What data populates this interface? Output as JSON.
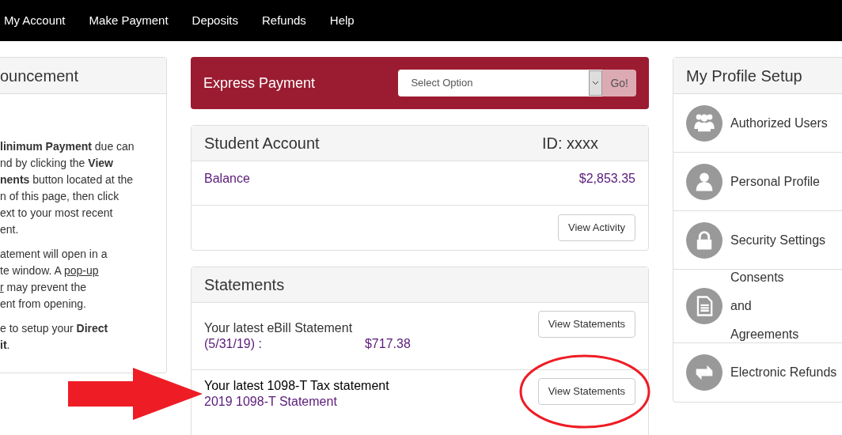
{
  "nav": {
    "items": [
      "My Account",
      "Make Payment",
      "Deposits",
      "Refunds",
      "Help"
    ]
  },
  "announcement": {
    "title": "ouncement",
    "paragraphs": [
      [
        [
          {
            "kind": "text",
            "text": "**linimum Payment** due can"
          }
        ],
        [
          {
            "kind": "text",
            "text": "nd by clicking the **View**"
          }
        ],
        [
          {
            "kind": "text",
            "text": "**nents** button located at the"
          }
        ],
        [
          {
            "kind": "text",
            "text": "n of this page, then click"
          }
        ],
        [
          {
            "kind": "text",
            "text": "ext to your most recent"
          }
        ],
        [
          {
            "kind": "text",
            "text": "ent."
          }
        ]
      ],
      [
        [
          {
            "kind": "text",
            "text": "atement will open in a"
          }
        ],
        [
          {
            "kind": "text",
            "text": "te window. A "
          },
          {
            "kind": "link",
            "text": "pop-up"
          }
        ],
        [
          {
            "kind": "link",
            "text": "r"
          },
          {
            "kind": "text",
            "text": " may prevent the"
          }
        ],
        [
          {
            "kind": "text",
            "text": "ent from opening."
          }
        ]
      ],
      [
        [
          {
            "kind": "text",
            "text": "e to setup your **Direct**"
          }
        ],
        [
          {
            "kind": "text",
            "text": "**it**."
          }
        ]
      ]
    ]
  },
  "express_payment": {
    "title": "Express Payment",
    "select": {
      "value": "Select Option"
    },
    "button": "Go!"
  },
  "student_account": {
    "title": "Student Account",
    "id": "ID: xxxx",
    "balance_label": "Balance",
    "balance": "$2,853.35",
    "button": "View Activity"
  },
  "statements": {
    "title": "Statements",
    "rows": [
      {
        "title": "Your latest eBill Statement",
        "detail": "(5/31/19) :",
        "amount": "$717.38",
        "button": "View Statements"
      },
      {
        "title": "Your latest 1098-T Tax statement",
        "detail": "2019 1098-T Statement",
        "button": "View Statements"
      }
    ]
  },
  "profile_setup": {
    "title": "My Profile Setup",
    "items": [
      "Authorized Users",
      "Personal Profile",
      "Security Settings",
      "Consents and Agreements",
      "Electronic Refunds"
    ]
  }
}
